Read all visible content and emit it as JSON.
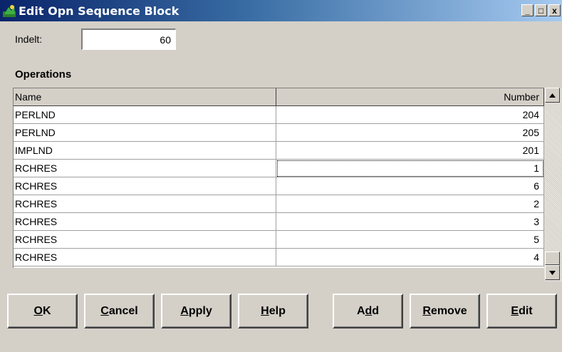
{
  "window": {
    "title": "Edit Opn Sequence Block"
  },
  "window_buttons": {
    "minimize": "_",
    "maximize": "□",
    "close": "x"
  },
  "indelt": {
    "label": "Indelt:",
    "value": "60"
  },
  "operations": {
    "label": "Operations",
    "columns": [
      "Name",
      "Number"
    ],
    "rows": [
      {
        "name": "PERLND",
        "number": "204"
      },
      {
        "name": "PERLND",
        "number": "205"
      },
      {
        "name": "IMPLND",
        "number": "201"
      },
      {
        "name": "RCHRES",
        "number": "1"
      },
      {
        "name": "RCHRES",
        "number": "6"
      },
      {
        "name": "RCHRES",
        "number": "2"
      },
      {
        "name": "RCHRES",
        "number": "3"
      },
      {
        "name": "RCHRES",
        "number": "5"
      },
      {
        "name": "RCHRES",
        "number": "4"
      }
    ],
    "focused_row": 3
  },
  "buttons": {
    "ok": {
      "mnemonic": "O",
      "rest": "K"
    },
    "cancel": {
      "mnemonic": "C",
      "rest": "ancel"
    },
    "apply": {
      "mnemonic": "A",
      "rest": "pply"
    },
    "help": {
      "mnemonic": "H",
      "rest": "elp"
    },
    "add": {
      "pre": "A",
      "mnemonic": "d",
      "rest": "d"
    },
    "remove": {
      "mnemonic": "R",
      "rest": "emove"
    },
    "edit": {
      "mnemonic": "E",
      "rest": "dit"
    }
  },
  "icons": {
    "app": "app-icon",
    "scroll_up": "scroll-up-arrow-icon",
    "scroll_down": "scroll-down-arrow-icon"
  }
}
